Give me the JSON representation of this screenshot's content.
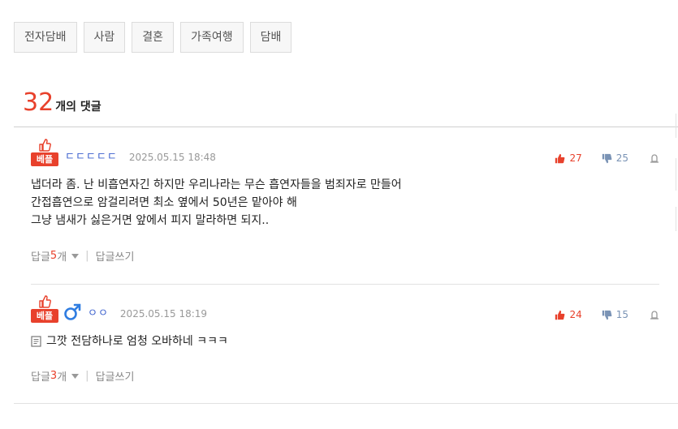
{
  "tags": [
    "전자담배",
    "사람",
    "결혼",
    "가족여행",
    "담배"
  ],
  "comment_count": {
    "number": "32",
    "label": "개의 댓글"
  },
  "comments": [
    {
      "badge": "베플",
      "author": "ㄷㄷㄷㄷㄷ",
      "date": "2025.05.15 18:48",
      "upvotes": "27",
      "downvotes": "25",
      "lines": [
        "냅더라 좀. 난 비흡연자긴 하지만 우리나라는 무슨 흡연자들을 범죄자로 만들어",
        "간접흡연으로 암걸리려면 최소 옆에서 50년은 맡아야 해",
        "그냥 냄새가 싫은거면 앞에서 피지 말라하면 되지.."
      ],
      "reply_prefix": "답글 ",
      "reply_count": "5",
      "reply_suffix": "개",
      "write_reply": "답글쓰기"
    },
    {
      "badge": "베플",
      "author": "ㅇㅇ",
      "date": "2025.05.15 18:19",
      "upvotes": "24",
      "downvotes": "15",
      "lines": [
        "그깟 전담하나로 엄청 오바하네 ㅋㅋㅋ"
      ],
      "reply_prefix": "답글 ",
      "reply_count": "3",
      "reply_suffix": "개",
      "write_reply": "답글쓰기"
    }
  ],
  "icons": {
    "thumb_up": "thumb-up-icon",
    "thumb_down": "thumb-down-icon",
    "report": "report-icon",
    "male": "male-icon",
    "memo": "memo-icon",
    "caret": "caret-down-icon"
  },
  "colors": {
    "accent": "#e8412c",
    "author": "#3a5fcd",
    "down": "#7a93b5",
    "male": "#2f7de1"
  }
}
